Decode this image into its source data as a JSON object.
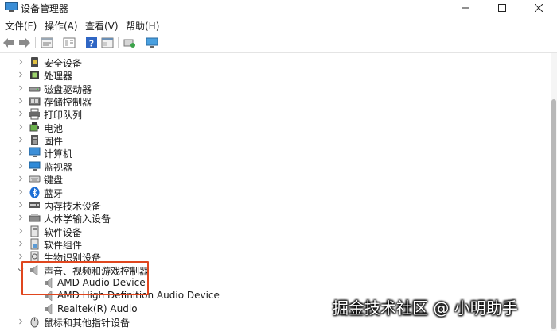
{
  "window": {
    "title": "设备管理器",
    "icon": "device-manager-icon"
  },
  "menu": [
    {
      "label": "文件(F)"
    },
    {
      "label": "操作(A)"
    },
    {
      "label": "查看(V)"
    },
    {
      "label": "帮助(H)"
    }
  ],
  "toolbar": [
    {
      "icon": "back-arrow-icon"
    },
    {
      "icon": "forward-arrow-icon"
    },
    {
      "icon": "properties-icon"
    },
    {
      "icon": "view-details-icon"
    },
    {
      "icon": "help-icon"
    },
    {
      "icon": "console-icon"
    },
    {
      "icon": "scan-hardware-icon"
    },
    {
      "icon": "monitor-icon"
    }
  ],
  "tree": {
    "categories": [
      {
        "label": "安全设备",
        "icon": "security-device-icon",
        "expanded": false
      },
      {
        "label": "处理器",
        "icon": "processor-icon",
        "expanded": false
      },
      {
        "label": "磁盘驱动器",
        "icon": "disk-drive-icon",
        "expanded": false
      },
      {
        "label": "存储控制器",
        "icon": "storage-controller-icon",
        "expanded": false
      },
      {
        "label": "打印队列",
        "icon": "printer-icon",
        "expanded": false
      },
      {
        "label": "电池",
        "icon": "battery-icon",
        "expanded": false
      },
      {
        "label": "固件",
        "icon": "firmware-icon",
        "expanded": false
      },
      {
        "label": "计算机",
        "icon": "computer-icon",
        "expanded": false
      },
      {
        "label": "监视器",
        "icon": "monitor-icon",
        "expanded": false
      },
      {
        "label": "键盘",
        "icon": "keyboard-icon",
        "expanded": false
      },
      {
        "label": "蓝牙",
        "icon": "bluetooth-icon",
        "expanded": false
      },
      {
        "label": "内存技术设备",
        "icon": "memory-device-icon",
        "expanded": false
      },
      {
        "label": "人体学输入设备",
        "icon": "hid-icon",
        "expanded": false
      },
      {
        "label": "软件设备",
        "icon": "software-device-icon",
        "expanded": false
      },
      {
        "label": "软件组件",
        "icon": "software-component-icon",
        "expanded": false
      },
      {
        "label": "生物识别设备",
        "icon": "biometric-icon",
        "expanded": false
      },
      {
        "label": "声音、视频和游戏控制器",
        "icon": "speaker-icon",
        "expanded": true
      },
      {
        "label": "AMD Audio Device",
        "icon": "speaker-icon",
        "child": true
      },
      {
        "label": "AMD High Definition Audio Device",
        "icon": "speaker-icon",
        "child": true
      },
      {
        "label": "Realtek(R) Audio",
        "icon": "speaker-icon",
        "child": true
      },
      {
        "label": "鼠标和其他指针设备",
        "icon": "mouse-icon",
        "expanded": false
      }
    ]
  },
  "watermark": "掘金技术社区 @ 小明助手",
  "colors": {
    "highlight": "#e0461e",
    "selected_bg": "#cce4f7"
  }
}
